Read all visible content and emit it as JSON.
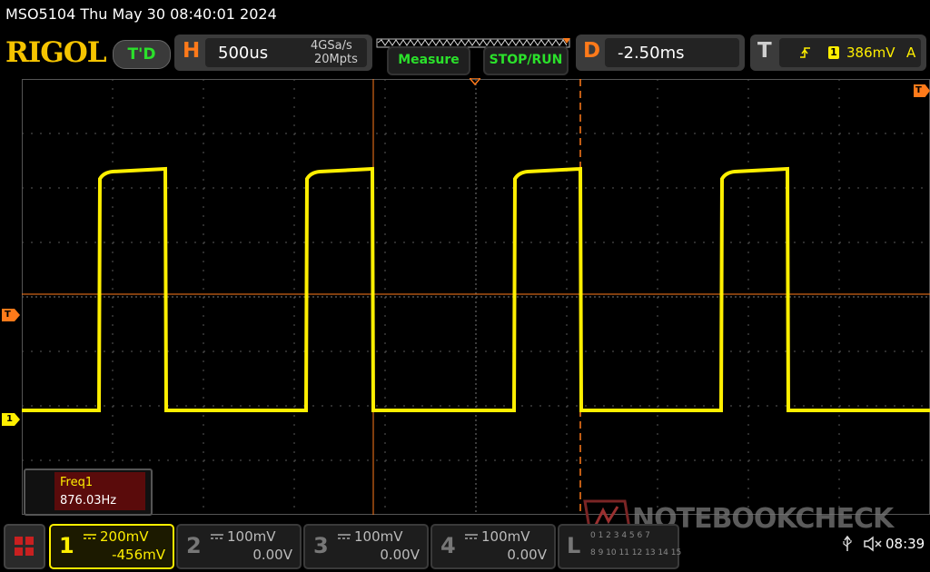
{
  "titlebar": {
    "text": "MSO5104  Thu May 30 08:40:01 2024"
  },
  "brand": {
    "logo": "RIGOL",
    "mode_badge": "T'D"
  },
  "horizontal": {
    "label": "H",
    "timebase": "500us",
    "sample_rate": "4GSa/s",
    "memory_depth": "20Mpts"
  },
  "buttons": {
    "measure": "Measure",
    "stop_run": "STOP/RUN"
  },
  "delay": {
    "label": "D",
    "value": "-2.50ms"
  },
  "trigger": {
    "label": "T",
    "source_badge": "1",
    "level": "386mV",
    "mode": "A",
    "marker_top": "T",
    "marker_left": "T"
  },
  "channel_marker": {
    "label": "1"
  },
  "measurement": {
    "name": "Freq1",
    "value": "876.03Hz"
  },
  "channels": [
    {
      "num": "1",
      "scale": "200mV",
      "offset": "-456mV",
      "color": "#ffef00"
    },
    {
      "num": "2",
      "scale": "100mV",
      "offset": "0.00V",
      "color": "#8a8a8a"
    },
    {
      "num": "3",
      "scale": "100mV",
      "offset": "0.00V",
      "color": "#8a8a8a"
    },
    {
      "num": "4",
      "scale": "100mV",
      "offset": "0.00V",
      "color": "#8a8a8a"
    }
  ],
  "logic": {
    "label": "L",
    "row1": "0 1 2 3 4 5 6 7",
    "row2": "8 9 10 11 12 13 14 15"
  },
  "watermark": "NOTEBOOKCHECK",
  "status": {
    "time": "08:39"
  },
  "colors": {
    "trace": "#ffef00",
    "cursor": "#ff7a1a",
    "accent_green": "#2be12b",
    "brand_yellow": "#f5c400"
  },
  "icons": [
    "menu-grid-icon",
    "usb-icon",
    "speaker-muted-icon",
    "trigger-edge-icon",
    "coupling-dc-icon"
  ]
}
